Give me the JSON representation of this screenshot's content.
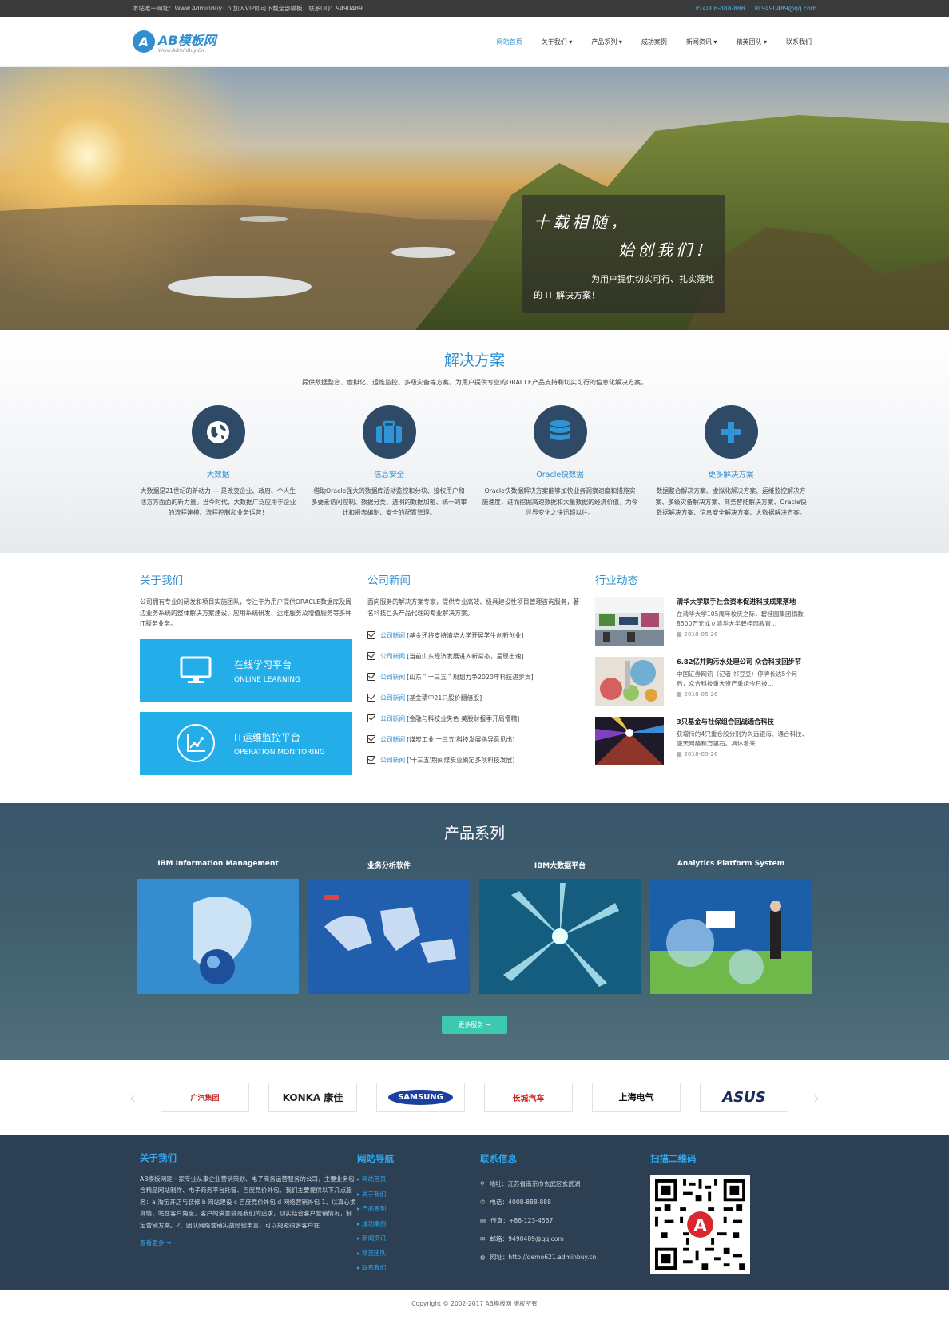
{
  "topbar": {
    "notice": "本站唯一网址：Www.AdminBuy.Cn 加入VIP即可下载全部模板，联系QQ：9490489",
    "phone": "4008-888-888",
    "email": "9490489@qq.com"
  },
  "header": {
    "logo_text": "AB模板网",
    "logo_sub": "Www.AdminBuy.Cn",
    "nav": [
      "网站首页",
      "关于我们 ▾",
      "产品系列 ▾",
      "成功案例",
      "新闻资讯 ▾",
      "精英团队 ▾",
      "联系我们"
    ]
  },
  "hero": {
    "line1": "十载相随，",
    "line2": "始创我们！",
    "line3": "为用户提供切实可行、扎实落地",
    "line4": "的 IT 解决方案！"
  },
  "solutions": {
    "title": "解决方案",
    "subtitle": "提供数据整合、虚拟化、运维监控、多级灾备等方案，为用户提供专业的ORACLE产品支持和切实可行的信息化解决方案。",
    "items": [
      {
        "name": "大数据",
        "icon": "globe-icon",
        "desc": "大数据是21世纪的新动力 — 是改变企业、政府、个人生活方方面面的新力量。当今时代，大数据广泛应用于企业的流程建模、流程控制和业务运营！"
      },
      {
        "name": "信息安全",
        "icon": "briefcase-icon",
        "desc": "借助Oracle强大的数据库活动监控和分块、接权用户和多要素访问控制、数据分类、透明的数据加密、统一的审计和报表编制、安全的配置管理。"
      },
      {
        "name": "Oracle快数据",
        "icon": "database-icon",
        "desc": "Oracle快数据解决方案能够加快业务洞察速度和措施实施速度，进而挖掘高速数据和大量数据的经济价值，为今世界变化之快迅超以往。"
      },
      {
        "name": "更多解决方案",
        "icon": "plus-icon",
        "desc": "数据整合解决方案、虚拟化解决方案、运维监控解决方案、多级灾备解决方案、商务智能解决方案、Oracle快数据解决方案、信息安全解决方案、大数据解决方案。"
      }
    ]
  },
  "about": {
    "title": "关于我们",
    "text": "公司拥有专业的研发和项目实施团队，专注于为用户提供ORACLE数据库及周边业务系统的整体解决方案建设、应用系统研发、运维服务及增值服务等多种IT服务业务。",
    "box1_title": "在线学习平台",
    "box1_sub": "ONLINE LEARNING",
    "box2_title": "IT运维监控平台",
    "box2_sub": "OPERATION MONITORING"
  },
  "company_news": {
    "title": "公司新闻",
    "intro": "面向服务的解决方案专家，提供专业高效、极具建设性项目管理咨询服务，著名科技巨头产品代理的专业解决方案。",
    "items": [
      {
        "cat": "公司新闻",
        "title": "[基金还将支持清华大学开展学生创新创业]"
      },
      {
        "cat": "公司新闻",
        "title": "[当前山东经济发展进入新常态，呈现出速]"
      },
      {
        "cat": "公司新闻",
        "title": "[山东＂十三五＂规划力争2020年科技进步贡]"
      },
      {
        "cat": "公司新闻",
        "title": "[基金猜中21只股价翻倍股]"
      },
      {
        "cat": "公司新闻",
        "title": "[金融与科技业失色 美股财报季开局懵糟]"
      },
      {
        "cat": "公司新闻",
        "title": "[煤炭工业'十三五'科技发展指导意见出]"
      },
      {
        "cat": "公司新闻",
        "title": "['十三五'期间煤炭业确定多项科技发展]"
      }
    ]
  },
  "industry": {
    "title": "行业动态",
    "items": [
      {
        "title": "清华大学联手社会资本促进科技成果落地",
        "desc": "在清华大学105周年校庆之际，碧桂园集团捐款8500万元成立清华大学碧桂园教育...",
        "date": "2018-05-26"
      },
      {
        "title": "6.82亿并购污水处理公司 众合科技回步节",
        "desc": "中国证券网讯（记者 祁豆豆）停牌长达5个月后，众合科技重大资产重组今日披...",
        "date": "2018-05-26"
      },
      {
        "title": "3只基金与社保组合回战通合科技",
        "desc": "获增持的4只重仓股分别为久远银海、通合科技、盛天网络和万里石。具体看来...",
        "date": "2018-05-26"
      }
    ]
  },
  "products": {
    "title": "产品系列",
    "items": [
      {
        "name": "IBM Information Management"
      },
      {
        "name": "业务分析软件"
      },
      {
        "name": "IBM大数据平台"
      },
      {
        "name": "Analytics Platform System"
      }
    ],
    "more": "更多服务 →"
  },
  "partners": [
    "广汽集团",
    "KONKA 康佳",
    "SAMSUNG",
    "长城汽车",
    "上海电气",
    "ASUS"
  ],
  "footer": {
    "about_title": "关于我们",
    "about_text": "AB模板网是一家专业从事企业营销策划、电子商务运营服务的公司，主要业务包含精品网站制作、电子商务平台托管、百度竞价外包、我们主要提供以下几点服务：a 淘宝开店与装修 b 网站建设 c 百度竞价外包 d 网络营销外包 1、以真心换真情，站在客户角度，客户的满意就是我们的追求，切实结合客户营销情况，制定营销方案。2、团队网络营销实战经验丰富，可以规避很多客户在...",
    "about_more": "查看更多 →",
    "nav_title": "网站导航",
    "nav_items": [
      "网站首页",
      "关于我们",
      "产品系列",
      "成功案例",
      "新闻资讯",
      "精英团队",
      "联系我们"
    ],
    "contact_title": "联系信息",
    "contact_items": [
      {
        "icon": "map-marker-icon",
        "text": "地址：江苏省南京市玄武区玄武湖"
      },
      {
        "icon": "phone-icon",
        "text": "电话：4008-888-888"
      },
      {
        "icon": "fax-icon",
        "text": "传真：+86-123-4567"
      },
      {
        "icon": "mail-icon",
        "text": "邮箱：9490489@qq.com"
      },
      {
        "icon": "globe-icon",
        "text": "网址：http://demo621.adminbuy.cn"
      }
    ],
    "qr_title": "扫描二维码"
  },
  "copyright": "Copyright © 2002-2017 AB模板网 版权所有",
  "colors": {
    "accent": "#2f8fd0",
    "footer_bg": "#2d3f52",
    "products_bg": "#3e5d6c",
    "blue_box": "#23aee9",
    "btn": "#3cc9b0"
  }
}
